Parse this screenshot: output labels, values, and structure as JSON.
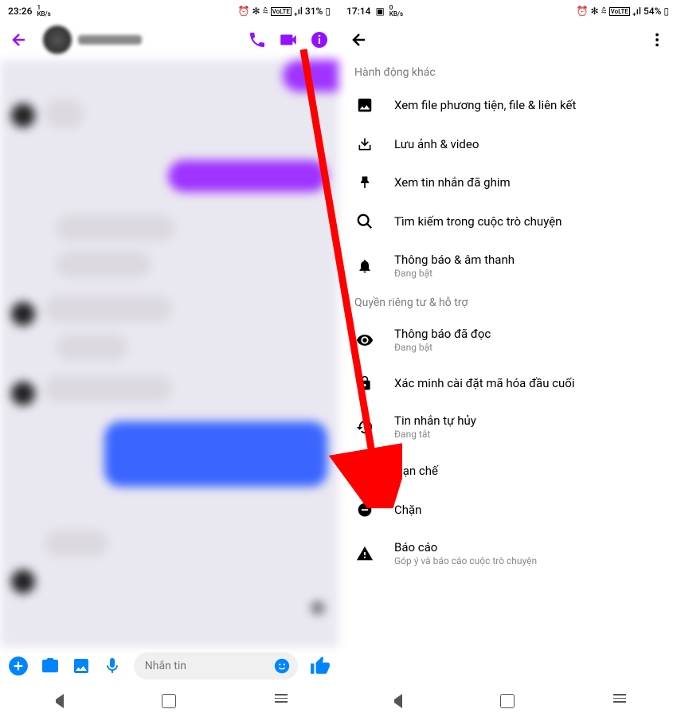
{
  "left": {
    "status": {
      "time": "23:26",
      "kbs": "1",
      "kbs_unit": "KB/s",
      "battery": "31%"
    },
    "composer_placeholder": "Nhắn tin"
  },
  "right": {
    "status": {
      "time": "17:14",
      "kbs": "0",
      "kbs_unit": "KB/s",
      "battery": "54%"
    },
    "section1": "Hành động khác",
    "section2": "Quyền riêng tư & hỗ trợ",
    "items": {
      "media": "Xem file phương tiện, file & liên kết",
      "save": "Lưu ảnh & video",
      "pinned": "Xem tin nhắn đã ghim",
      "search": "Tìm kiếm trong cuộc trò chuyện",
      "notif": "Thông báo & âm thanh",
      "notif_sub": "Đang bật",
      "readrec": "Thông báo đã đọc",
      "readrec_sub": "Đang bật",
      "verify": "Xác minh cài đặt mã hóa đầu cuối",
      "disappear": "Tin nhắn tự hủy",
      "disappear_sub": "Đang tắt",
      "restrict": "Hạn chế",
      "block": "Chặn",
      "report": "Báo cáo",
      "report_sub": "Góp ý và báo cáo cuộc trò chuyện"
    }
  }
}
